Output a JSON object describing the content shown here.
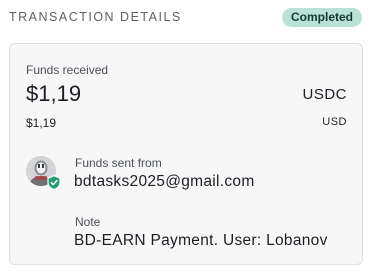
{
  "header": {
    "title": "TRANSACTION DETAILS",
    "status": "Completed"
  },
  "colors": {
    "status_badge_bg": "#b7e2d5",
    "verified_shield": "#1e9e73",
    "card_bg": "#f7f7f8"
  },
  "amount": {
    "label": "Funds received",
    "value": "$1,19",
    "currency": "USDC",
    "fiat_value": "$1,19",
    "fiat_currency": "USD"
  },
  "sender": {
    "label": "Funds sent from",
    "email": "bdtasks2025@gmail.com",
    "avatar_icon": "avatar-icon",
    "verified_icon": "verified-shield-icon"
  },
  "note": {
    "label": "Note",
    "text": "BD-EARN Payment. User: Lobanov"
  }
}
